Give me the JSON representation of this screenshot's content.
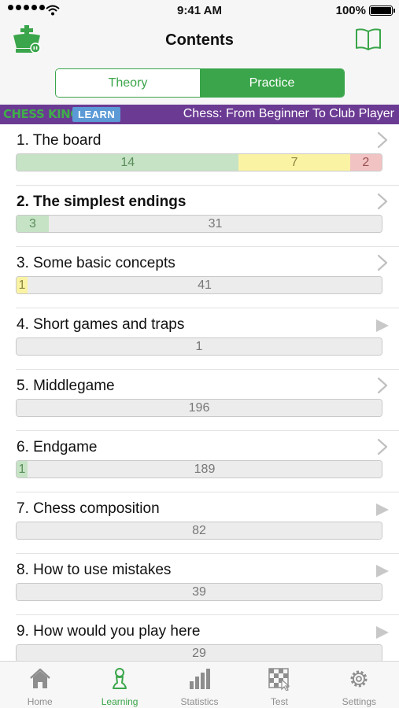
{
  "status_bar": {
    "time": "9:41 AM",
    "battery": "100%"
  },
  "nav": {
    "title": "Contents"
  },
  "segments": [
    {
      "label": "Theory",
      "selected": false
    },
    {
      "label": "Practice",
      "selected": true
    }
  ],
  "banner": {
    "brand": "CHESS KING",
    "badge": "LEARN",
    "course": "Chess: From Beginner To Club Player"
  },
  "chapters": [
    {
      "title": "1. The board",
      "bold": false,
      "icon": "chevron-right-icon",
      "segments": [
        {
          "value": "14",
          "color": "green"
        },
        {
          "value": "7",
          "color": "yellow"
        },
        {
          "value": "2",
          "color": "red"
        }
      ]
    },
    {
      "title": "2. The simplest endings",
      "bold": true,
      "icon": "chevron-right-icon",
      "segments": [
        {
          "value": "3",
          "color": "green"
        },
        {
          "value": "31",
          "color": "gray"
        }
      ]
    },
    {
      "title": "3. Some basic concepts",
      "bold": false,
      "icon": "chevron-right-icon",
      "segments": [
        {
          "value": "1",
          "color": "yellow"
        },
        {
          "value": "41",
          "color": "gray"
        }
      ]
    },
    {
      "title": "4. Short games and traps",
      "bold": false,
      "icon": "play-icon",
      "segments": [
        {
          "value": "1",
          "color": "gray"
        }
      ]
    },
    {
      "title": "5. Middlegame",
      "bold": false,
      "icon": "chevron-right-icon",
      "segments": [
        {
          "value": "196",
          "color": "gray"
        }
      ]
    },
    {
      "title": "6. Endgame",
      "bold": false,
      "icon": "chevron-right-icon",
      "segments": [
        {
          "value": "1",
          "color": "green"
        },
        {
          "value": "189",
          "color": "gray"
        }
      ]
    },
    {
      "title": "7. Chess composition",
      "bold": false,
      "icon": "play-icon",
      "segments": [
        {
          "value": "82",
          "color": "gray"
        }
      ]
    },
    {
      "title": "8. How to use mistakes",
      "bold": false,
      "icon": "play-icon",
      "segments": [
        {
          "value": "39",
          "color": "gray"
        }
      ]
    },
    {
      "title": "9. How would you play here",
      "bold": false,
      "icon": "play-icon",
      "segments": [
        {
          "value": "29",
          "color": "gray"
        }
      ]
    }
  ],
  "tabs": [
    {
      "label": "Home",
      "icon": "home-icon",
      "active": false
    },
    {
      "label": "Learning",
      "icon": "pawn-icon",
      "active": true
    },
    {
      "label": "Statistics",
      "icon": "bar-chart-icon",
      "active": false
    },
    {
      "label": "Test",
      "icon": "chessboard-cursor-icon",
      "active": false
    },
    {
      "label": "Settings",
      "icon": "gear-icon",
      "active": false
    }
  ],
  "colors": {
    "accent": "#3aa54a",
    "banner": "#6b3a93",
    "badge": "#5b9ad6",
    "green": "#c6e3c6",
    "yellow": "#fbf3a4",
    "red": "#f2c3c3",
    "gray": "#ececec"
  }
}
